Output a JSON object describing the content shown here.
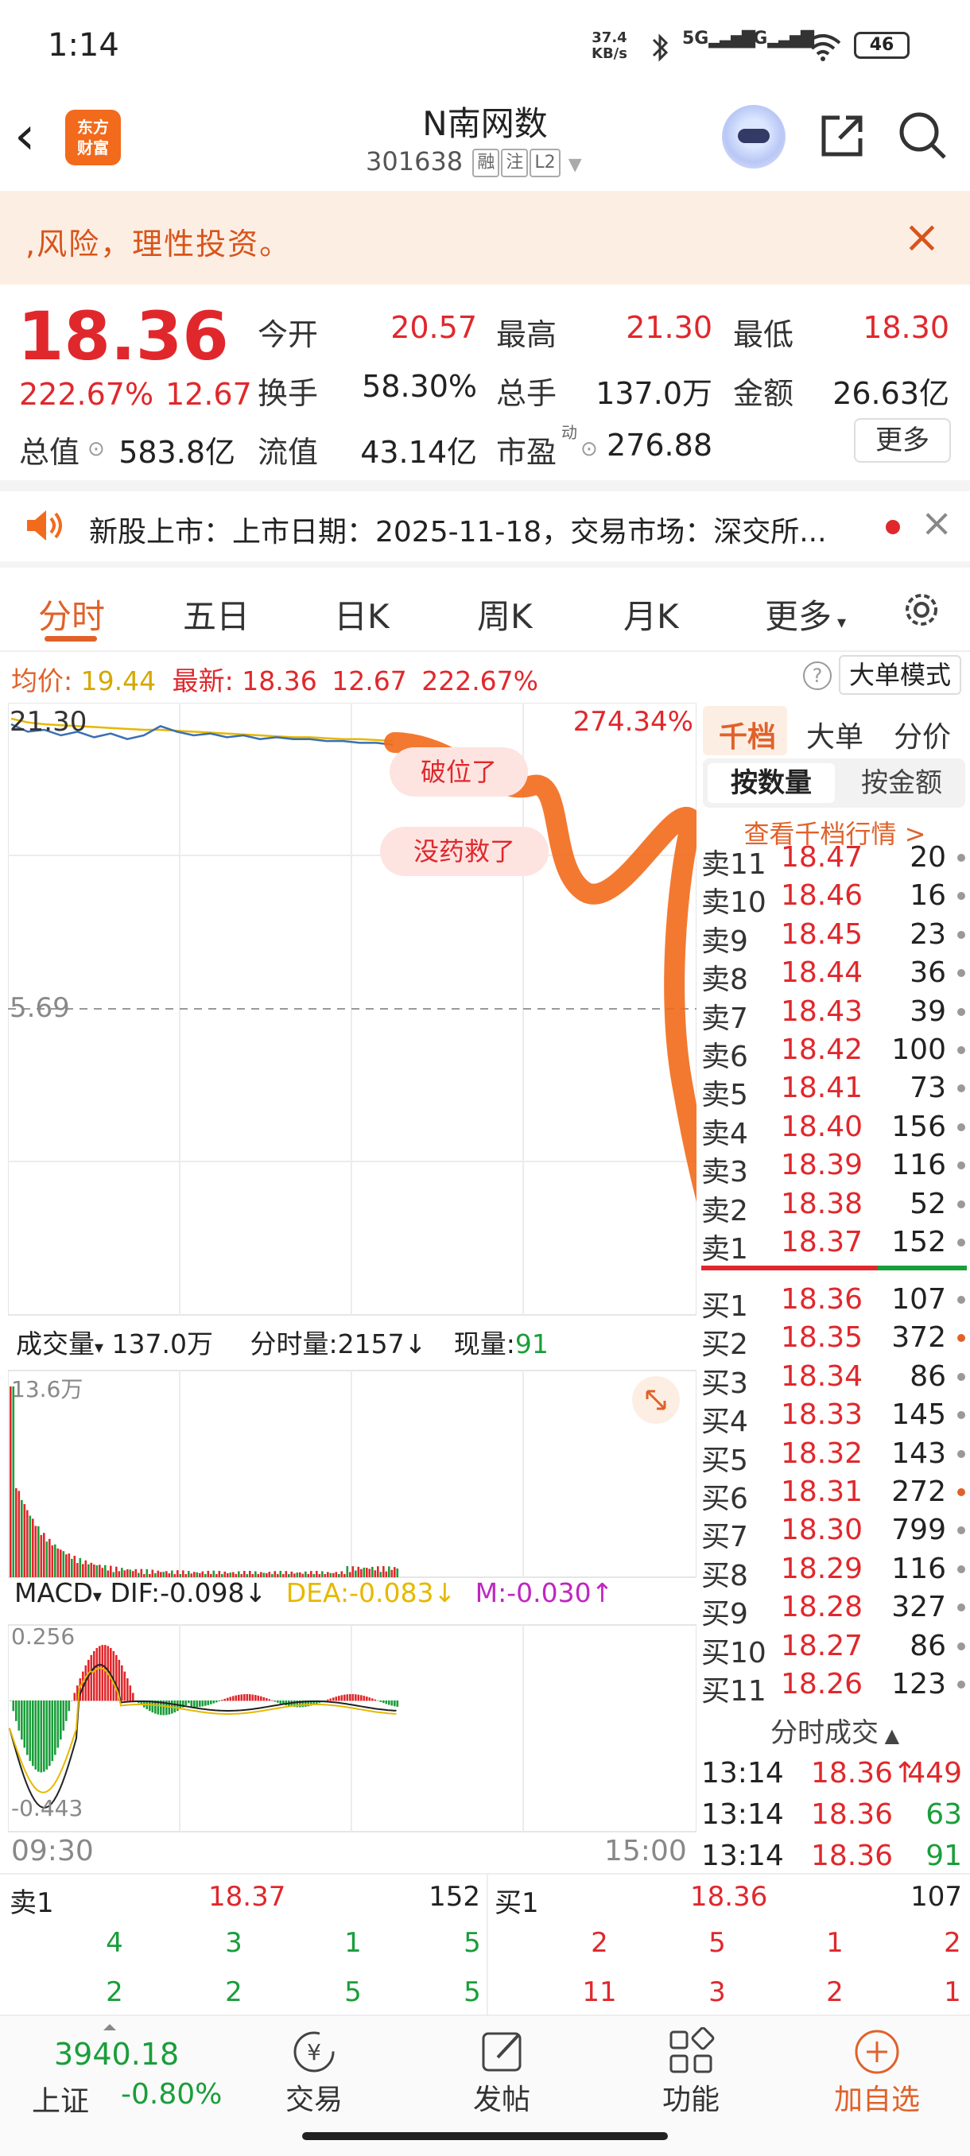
{
  "status": {
    "time": "1:14",
    "net_speed_value": "37.4",
    "net_speed_unit": "KB/s",
    "sig1": "5G",
    "sig2": "5G",
    "battery": "46"
  },
  "header": {
    "name": "N南网数",
    "code": "301638",
    "tags": [
      "融",
      "注",
      "L2"
    ],
    "back_icon": "chevron-left-icon",
    "logo_line1": "东方",
    "logo_line2": "财富"
  },
  "banner": {
    "text": ",风险，理性投资。"
  },
  "quote": {
    "price": "18.36",
    "pct": "222.67%",
    "chg": "12.67",
    "open_label": "今开",
    "open": "20.57",
    "high_label": "最高",
    "high": "21.30",
    "low_label": "最低",
    "low": "18.30",
    "turnover_label": "换手",
    "turnover": "58.30%",
    "volume_label": "总手",
    "volume": "137.0万",
    "amount_label": "金额",
    "amount": "26.63亿",
    "mktcap_label": "总值",
    "mktcap": "583.8亿",
    "float_label": "流值",
    "float": "43.14亿",
    "pe_label": "市盈",
    "pe_sup": "动",
    "pe": "276.88",
    "more": "更多"
  },
  "notice": {
    "text": "新股上市：上市日期：2025-11-18，交易市场：深交所..."
  },
  "tabs": [
    "分时",
    "五日",
    "日K",
    "周K",
    "月K",
    "更多"
  ],
  "info": {
    "avg_label": "均价:",
    "avg": "19.44",
    "last_label": "最新:",
    "last": "18.36",
    "chg": "12.67",
    "pct": "222.67%",
    "mode": "大单模式",
    "help": "?"
  },
  "chart": {
    "top_left": "21.30",
    "top_right": "274.34%",
    "mid": "5.69",
    "annotation1": "破位了",
    "annotation2": "没药救了",
    "vol_label": "成交量",
    "vol_total": "137.0万",
    "tick_label": "分时量:",
    "tick_val": "2157↓",
    "now_label": "现量:",
    "now_val": "91",
    "vol_max": "13.6万",
    "macd_label": "MACD",
    "dif": "DIF:-0.098↓",
    "dea": "DEA:-0.083↓",
    "m": "M:-0.030↑",
    "macd_max": "0.256",
    "macd_min": "-0.443",
    "t_start": "09:30",
    "t_end": "15:00"
  },
  "chart_data": {
    "type": "line",
    "series": [
      {
        "name": "最新",
        "values": [
          21.0,
          20.6,
          20.7,
          20.4,
          20.6,
          20.3,
          20.5,
          20.2,
          20.4,
          20.9,
          20.6,
          20.4,
          20.5,
          20.3,
          20.4,
          20.2,
          20.3,
          20.2,
          20.2,
          20.1,
          20.1,
          20.0,
          20.0,
          19.9
        ]
      },
      {
        "name": "均价",
        "values": [
          21.3,
          21.1,
          21.0,
          20.95,
          20.9,
          20.85,
          20.8,
          20.75,
          20.7,
          20.7,
          20.65,
          20.6,
          20.55,
          20.5,
          20.45,
          20.4,
          20.35,
          20.3,
          20.3,
          20.25,
          20.2,
          20.2,
          20.15,
          20.1
        ]
      }
    ],
    "ylim": [
      5.69,
      21.3
    ]
  },
  "panel": {
    "tabs": [
      "千档",
      "大单",
      "分价"
    ],
    "seg_on": "按数量",
    "seg_off": "按金额",
    "view": "查看千档行情 >"
  },
  "asks": [
    {
      "l": "卖11",
      "p": "18.47",
      "v": "20",
      "dot": "#999"
    },
    {
      "l": "卖10",
      "p": "18.46",
      "v": "16",
      "dot": "#999"
    },
    {
      "l": "卖9",
      "p": "18.45",
      "v": "23",
      "dot": "#999"
    },
    {
      "l": "卖8",
      "p": "18.44",
      "v": "36",
      "dot": "#999"
    },
    {
      "l": "卖7",
      "p": "18.43",
      "v": "39",
      "dot": "#999"
    },
    {
      "l": "卖6",
      "p": "18.42",
      "v": "100",
      "dot": "#999"
    },
    {
      "l": "卖5",
      "p": "18.41",
      "v": "73",
      "dot": "#999"
    },
    {
      "l": "卖4",
      "p": "18.40",
      "v": "156",
      "dot": "#999"
    },
    {
      "l": "卖3",
      "p": "18.39",
      "v": "116",
      "dot": "#999"
    },
    {
      "l": "卖2",
      "p": "18.38",
      "v": "52",
      "dot": "#999"
    },
    {
      "l": "卖1",
      "p": "18.37",
      "v": "152",
      "dot": "#999"
    }
  ],
  "bids": [
    {
      "l": "买1",
      "p": "18.36",
      "v": "107",
      "dot": "#999"
    },
    {
      "l": "买2",
      "p": "18.35",
      "v": "372",
      "dot": "#e0622a"
    },
    {
      "l": "买3",
      "p": "18.34",
      "v": "86",
      "dot": "#999"
    },
    {
      "l": "买4",
      "p": "18.33",
      "v": "145",
      "dot": "#999"
    },
    {
      "l": "买5",
      "p": "18.32",
      "v": "143",
      "dot": "#999"
    },
    {
      "l": "买6",
      "p": "18.31",
      "v": "272",
      "dot": "#e0622a"
    },
    {
      "l": "买7",
      "p": "18.30",
      "v": "799",
      "dot": "#999"
    },
    {
      "l": "买8",
      "p": "18.29",
      "v": "116",
      "dot": "#999"
    },
    {
      "l": "买9",
      "p": "18.28",
      "v": "327",
      "dot": "#999"
    },
    {
      "l": "买10",
      "p": "18.27",
      "v": "86",
      "dot": "#999"
    },
    {
      "l": "买11",
      "p": "18.26",
      "v": "123",
      "dot": "#999"
    }
  ],
  "ticks_title": "分时成交",
  "ticks": [
    {
      "t": "13:14",
      "p": "18.36↑",
      "v": "449",
      "vc": "#e0282c"
    },
    {
      "t": "13:14",
      "p": "18.36",
      "v": "63",
      "vc": "#1a9e3a"
    },
    {
      "t": "13:14",
      "p": "18.36",
      "v": "91",
      "vc": "#1a9e3a"
    }
  ],
  "level": {
    "ask_label": "卖1",
    "ask_price": "18.37",
    "ask_vol": "152",
    "bid_label": "买1",
    "bid_price": "18.36",
    "bid_vol": "107",
    "ask_row1": [
      "4",
      "3",
      "1",
      "5"
    ],
    "ask_row2": [
      "2",
      "2",
      "5",
      "5"
    ],
    "bid_row1": [
      "2",
      "5",
      "1",
      "2"
    ],
    "bid_row2": [
      "11",
      "3",
      "2",
      "1"
    ]
  },
  "footer": {
    "index": "3940.18",
    "index_name": "上证",
    "index_pct": "-0.80%",
    "items": [
      "交易",
      "发帖",
      "功能",
      "加自选"
    ]
  }
}
